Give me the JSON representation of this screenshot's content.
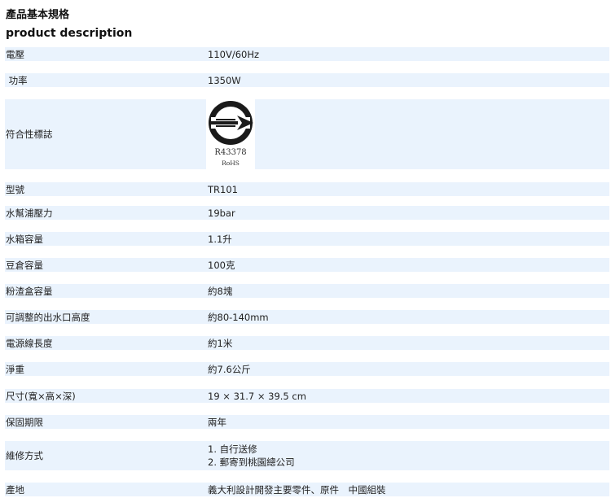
{
  "title_zh": "產品基本規格",
  "title_en": "product description",
  "specs": [
    {
      "label": "電壓",
      "value": "110V/60Hz"
    },
    {
      "label": " 功率",
      "value": "1350W"
    },
    {
      "label": "符合性標誌",
      "mark": {
        "icon": "bsmi-certification-mark",
        "number": "R43378",
        "sub": "RoHS"
      }
    },
    {
      "label": "型號",
      "value": "TR101"
    },
    {
      "label": "水幫浦壓力",
      "value": "19bar"
    },
    {
      "label": "水箱容量",
      "value": "1.1升"
    },
    {
      "label": "豆倉容量",
      "value": "100克"
    },
    {
      "label": "粉渣盒容量",
      "value": "約8塊"
    },
    {
      "label": "可調整的出水口高度",
      "value": "約80-140mm"
    },
    {
      "label": "電源線長度",
      "value": "約1米"
    },
    {
      "label": "淨重",
      "value": "約7.6公斤"
    },
    {
      "label": "尺寸(寬×高×深)",
      "value": "19 × 31.7 × 39.5 cm"
    },
    {
      "label": "保固期限",
      "value": "兩年"
    },
    {
      "label": "維修方式",
      "value_lines": [
        "1. 自行送修",
        "2. 郵寄到桃園總公司"
      ]
    },
    {
      "label": "產地",
      "value": "義大利設計開發主要零件、原件　中國組裝"
    }
  ],
  "colors": {
    "row_band": "#eaf3fd",
    "text": "#222222"
  }
}
